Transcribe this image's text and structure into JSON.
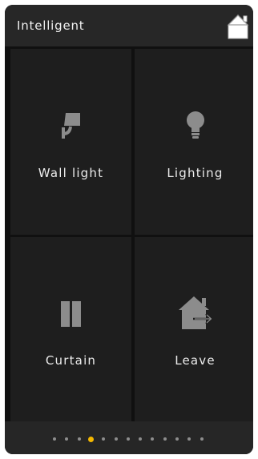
{
  "header": {
    "title": "Intelligent",
    "home_icon": "home-icon"
  },
  "tiles": [
    {
      "label": "Wall light",
      "icon": "wall-light-icon"
    },
    {
      "label": "Lighting",
      "icon": "bulb-icon"
    },
    {
      "label": "Curtain",
      "icon": "curtain-icon"
    },
    {
      "label": "Leave",
      "icon": "leave-home-icon"
    }
  ],
  "pager": {
    "page_count": 13,
    "current_page": 4
  },
  "colors": {
    "background": "#101010",
    "header": "#272727",
    "tile": "#1e1e1e",
    "icon": "#8c8c8c",
    "text": "#ececec",
    "accent": "#f5b800"
  }
}
